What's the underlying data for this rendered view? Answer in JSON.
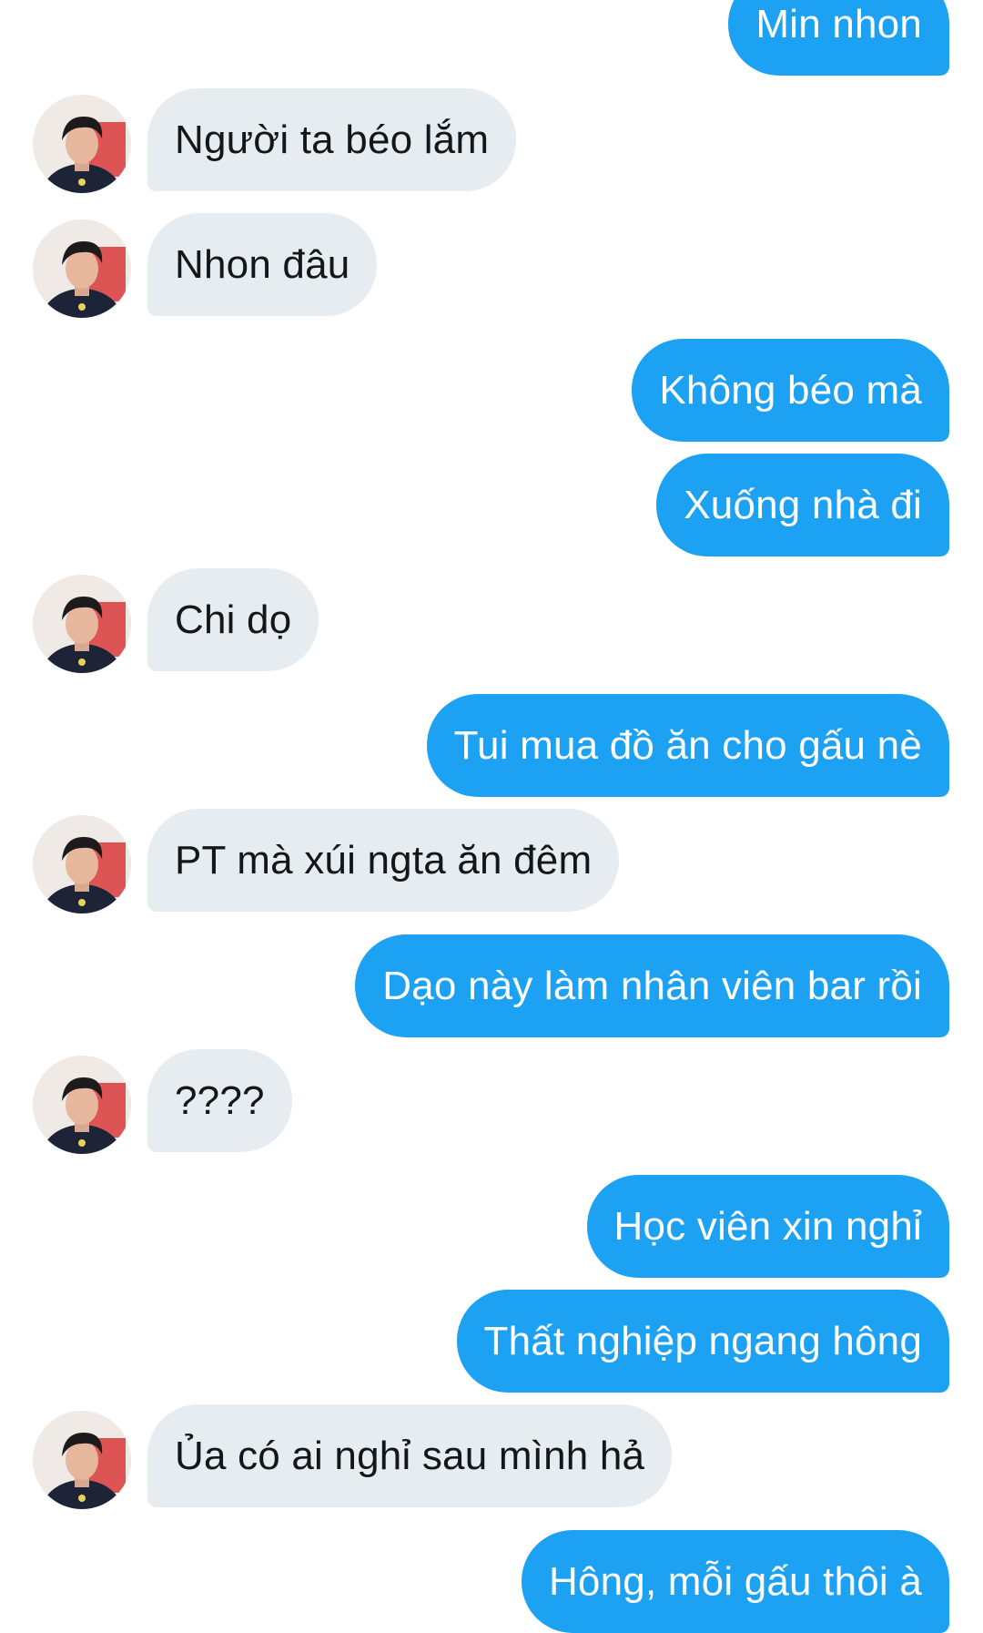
{
  "messages": [
    {
      "side": "out",
      "text": "Min nhon"
    },
    {
      "side": "in",
      "text": "Người ta béo lắm"
    },
    {
      "side": "in",
      "text": "Nhon đâu"
    },
    {
      "side": "out",
      "text": "Không béo mà"
    },
    {
      "side": "out",
      "text": "Xuống nhà đi"
    },
    {
      "side": "in",
      "text": "Chi dọ"
    },
    {
      "side": "out",
      "text": "Tui mua đồ ăn cho gấu nè"
    },
    {
      "side": "in",
      "text": "PT mà xúi ngta ăn đêm"
    },
    {
      "side": "out",
      "text": "Dạo này làm nhân viên bar rồi"
    },
    {
      "side": "in",
      "text": "????"
    },
    {
      "side": "out",
      "text": "Học viên xin nghỉ"
    },
    {
      "side": "out",
      "text": "Thất nghiệp ngang hông"
    },
    {
      "side": "in",
      "text": "Ủa có ai nghỉ sau mình hả"
    },
    {
      "side": "out",
      "text": "Hông, mỗi gấu thôi à"
    }
  ],
  "colors": {
    "outgoing_bubble": "#1da1f2",
    "incoming_bubble": "#e6ecf0",
    "outgoing_text": "#ffffff",
    "incoming_text": "#14171a"
  },
  "icons": {
    "avatar": "user-avatar-icon"
  }
}
